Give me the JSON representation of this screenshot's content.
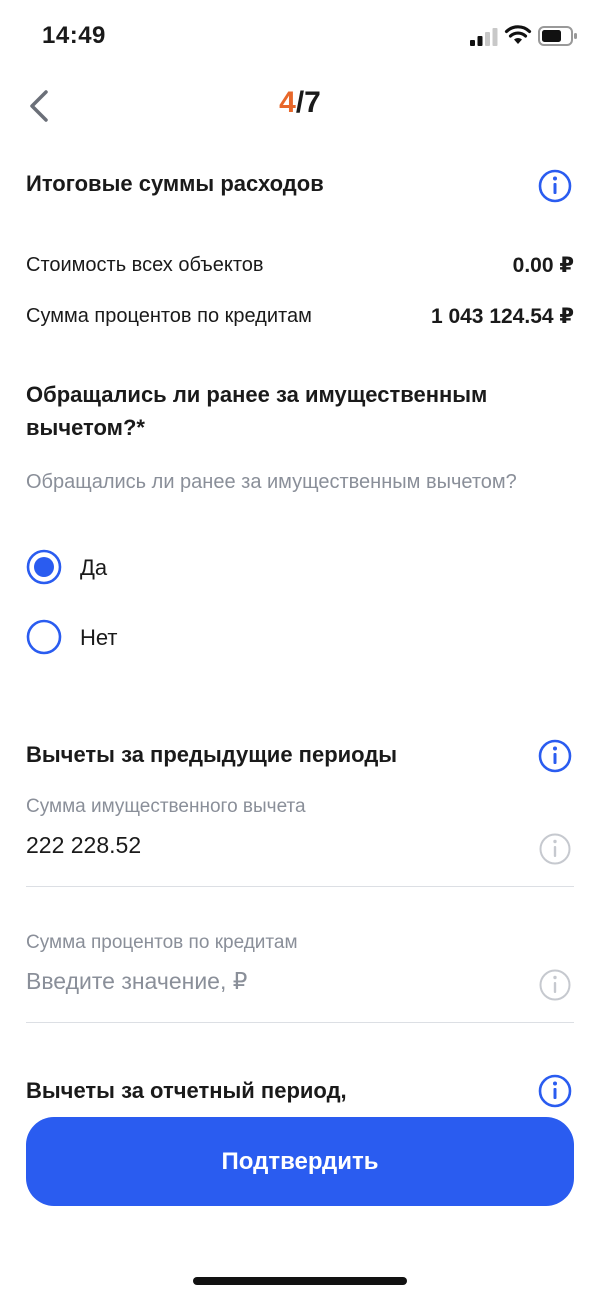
{
  "status_bar": {
    "time": "14:49"
  },
  "header": {
    "step_current": "4",
    "step_rest": "/7"
  },
  "summary": {
    "title": "Итоговые суммы расходов",
    "rows": [
      {
        "label": "Стоимость всех объектов",
        "value": "0.00 ₽"
      },
      {
        "label": "Сумма процентов по кредитам",
        "value": "1 043 124.54 ₽"
      }
    ]
  },
  "question": {
    "title": "Обращались ли ранее за имущественным вычетом?*",
    "subtitle": "Обращались ли ранее за имущественным вычетом?",
    "options": [
      {
        "label": "Да",
        "selected": true
      },
      {
        "label": "Нет",
        "selected": false
      }
    ]
  },
  "previous_periods": {
    "title": "Вычеты за предыдущие периоды",
    "fields": [
      {
        "label": "Сумма имущественного вычета",
        "value": "222 228.52",
        "placeholder": ""
      },
      {
        "label": "Сумма процентов по кредитам",
        "value": "",
        "placeholder": "Введите значение, ₽"
      }
    ]
  },
  "reporting_period": {
    "title": "Вычеты за отчетный период,"
  },
  "footer": {
    "confirm_label": "Подтвердить"
  },
  "colors": {
    "accent": "#2a5cf0",
    "step_highlight": "#e8672a",
    "muted_text": "#8a8f99"
  }
}
